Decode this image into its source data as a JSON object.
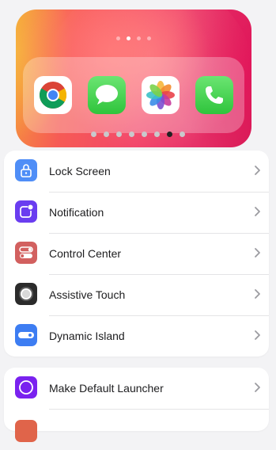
{
  "preview": {
    "top_page_dots": 4,
    "top_page_active": 1,
    "dock_apps": [
      {
        "name": "chrome",
        "icon": "chrome-icon"
      },
      {
        "name": "messages",
        "icon": "messages-icon"
      },
      {
        "name": "photos",
        "icon": "photos-icon"
      },
      {
        "name": "phone",
        "icon": "phone-icon"
      }
    ]
  },
  "pager": {
    "count": 8,
    "active_index": 6
  },
  "settings": {
    "items": [
      {
        "label": "Lock Screen",
        "icon": "lock-icon",
        "color": "#4f8ef7"
      },
      {
        "label": "Notification",
        "icon": "notification-icon",
        "color": "#6a3df0"
      },
      {
        "label": "Control Center",
        "icon": "toggle-icon",
        "color": "#d2605f"
      },
      {
        "label": "Assistive Touch",
        "icon": "assistive-touch-icon",
        "color": "#2b2b2b"
      },
      {
        "label": "Dynamic Island",
        "icon": "dynamic-island-icon",
        "color": "#3d7df2"
      }
    ],
    "secondary": [
      {
        "label": "Make Default Launcher",
        "icon": "launcher-circle-icon",
        "color": "#7a22ef"
      }
    ]
  }
}
